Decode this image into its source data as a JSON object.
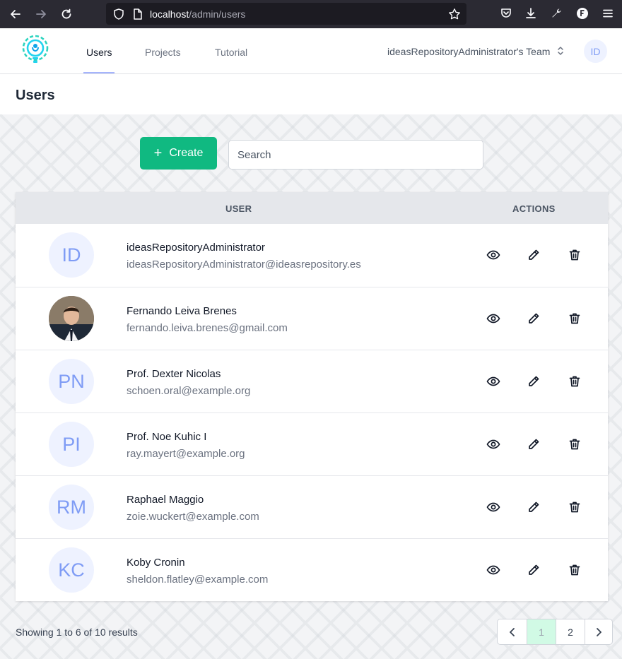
{
  "browser": {
    "url_host": "localhost",
    "url_path": "/admin/users"
  },
  "header": {
    "tabs": [
      {
        "label": "Users",
        "active": true
      },
      {
        "label": "Projects",
        "active": false
      },
      {
        "label": "Tutorial",
        "active": false
      }
    ],
    "team_name": "ideasRepositoryAdministrator's Team",
    "avatar_initials": "ID"
  },
  "page": {
    "title": "Users"
  },
  "toolbar": {
    "create_label": "Create",
    "search_placeholder": "Search"
  },
  "table": {
    "columns": {
      "user": "USER",
      "actions": "ACTIONS"
    },
    "rows": [
      {
        "initials": "ID",
        "name": "ideasRepositoryAdministrator",
        "email": "ideasRepositoryAdministrator@ideasrepository.es",
        "has_photo": false
      },
      {
        "initials": "",
        "name": "Fernando Leiva Brenes",
        "email": "fernando.leiva.brenes@gmail.com",
        "has_photo": true
      },
      {
        "initials": "PN",
        "name": "Prof. Dexter Nicolas",
        "email": "schoen.oral@example.org",
        "has_photo": false
      },
      {
        "initials": "PI",
        "name": "Prof. Noe Kuhic I",
        "email": "ray.mayert@example.org",
        "has_photo": false
      },
      {
        "initials": "RM",
        "name": "Raphael Maggio",
        "email": "zoie.wuckert@example.com",
        "has_photo": false
      },
      {
        "initials": "KC",
        "name": "Koby Cronin",
        "email": "sheldon.flatley@example.com",
        "has_photo": false
      }
    ]
  },
  "footer": {
    "results_text": "Showing 1 to 6 of 10 results",
    "pages": [
      "1",
      "2"
    ],
    "current_page": "1"
  },
  "colors": {
    "accent_green": "#10b981",
    "avatar_bg": "#eef2ff",
    "avatar_text": "#7f9cf5",
    "current_page_bg": "#d1fae5"
  },
  "icons": {
    "back": "arrow-left-icon",
    "forward": "arrow-right-icon",
    "reload": "reload-icon",
    "shield": "shield-icon",
    "page": "page-icon",
    "bookmark": "star-icon",
    "pocket": "pocket-icon",
    "download": "download-icon",
    "tools": "wrench-icon",
    "account": "account-icon",
    "menu": "hamburger-menu-icon",
    "view": "eye-icon",
    "edit": "pencil-icon",
    "delete": "trash-icon"
  }
}
